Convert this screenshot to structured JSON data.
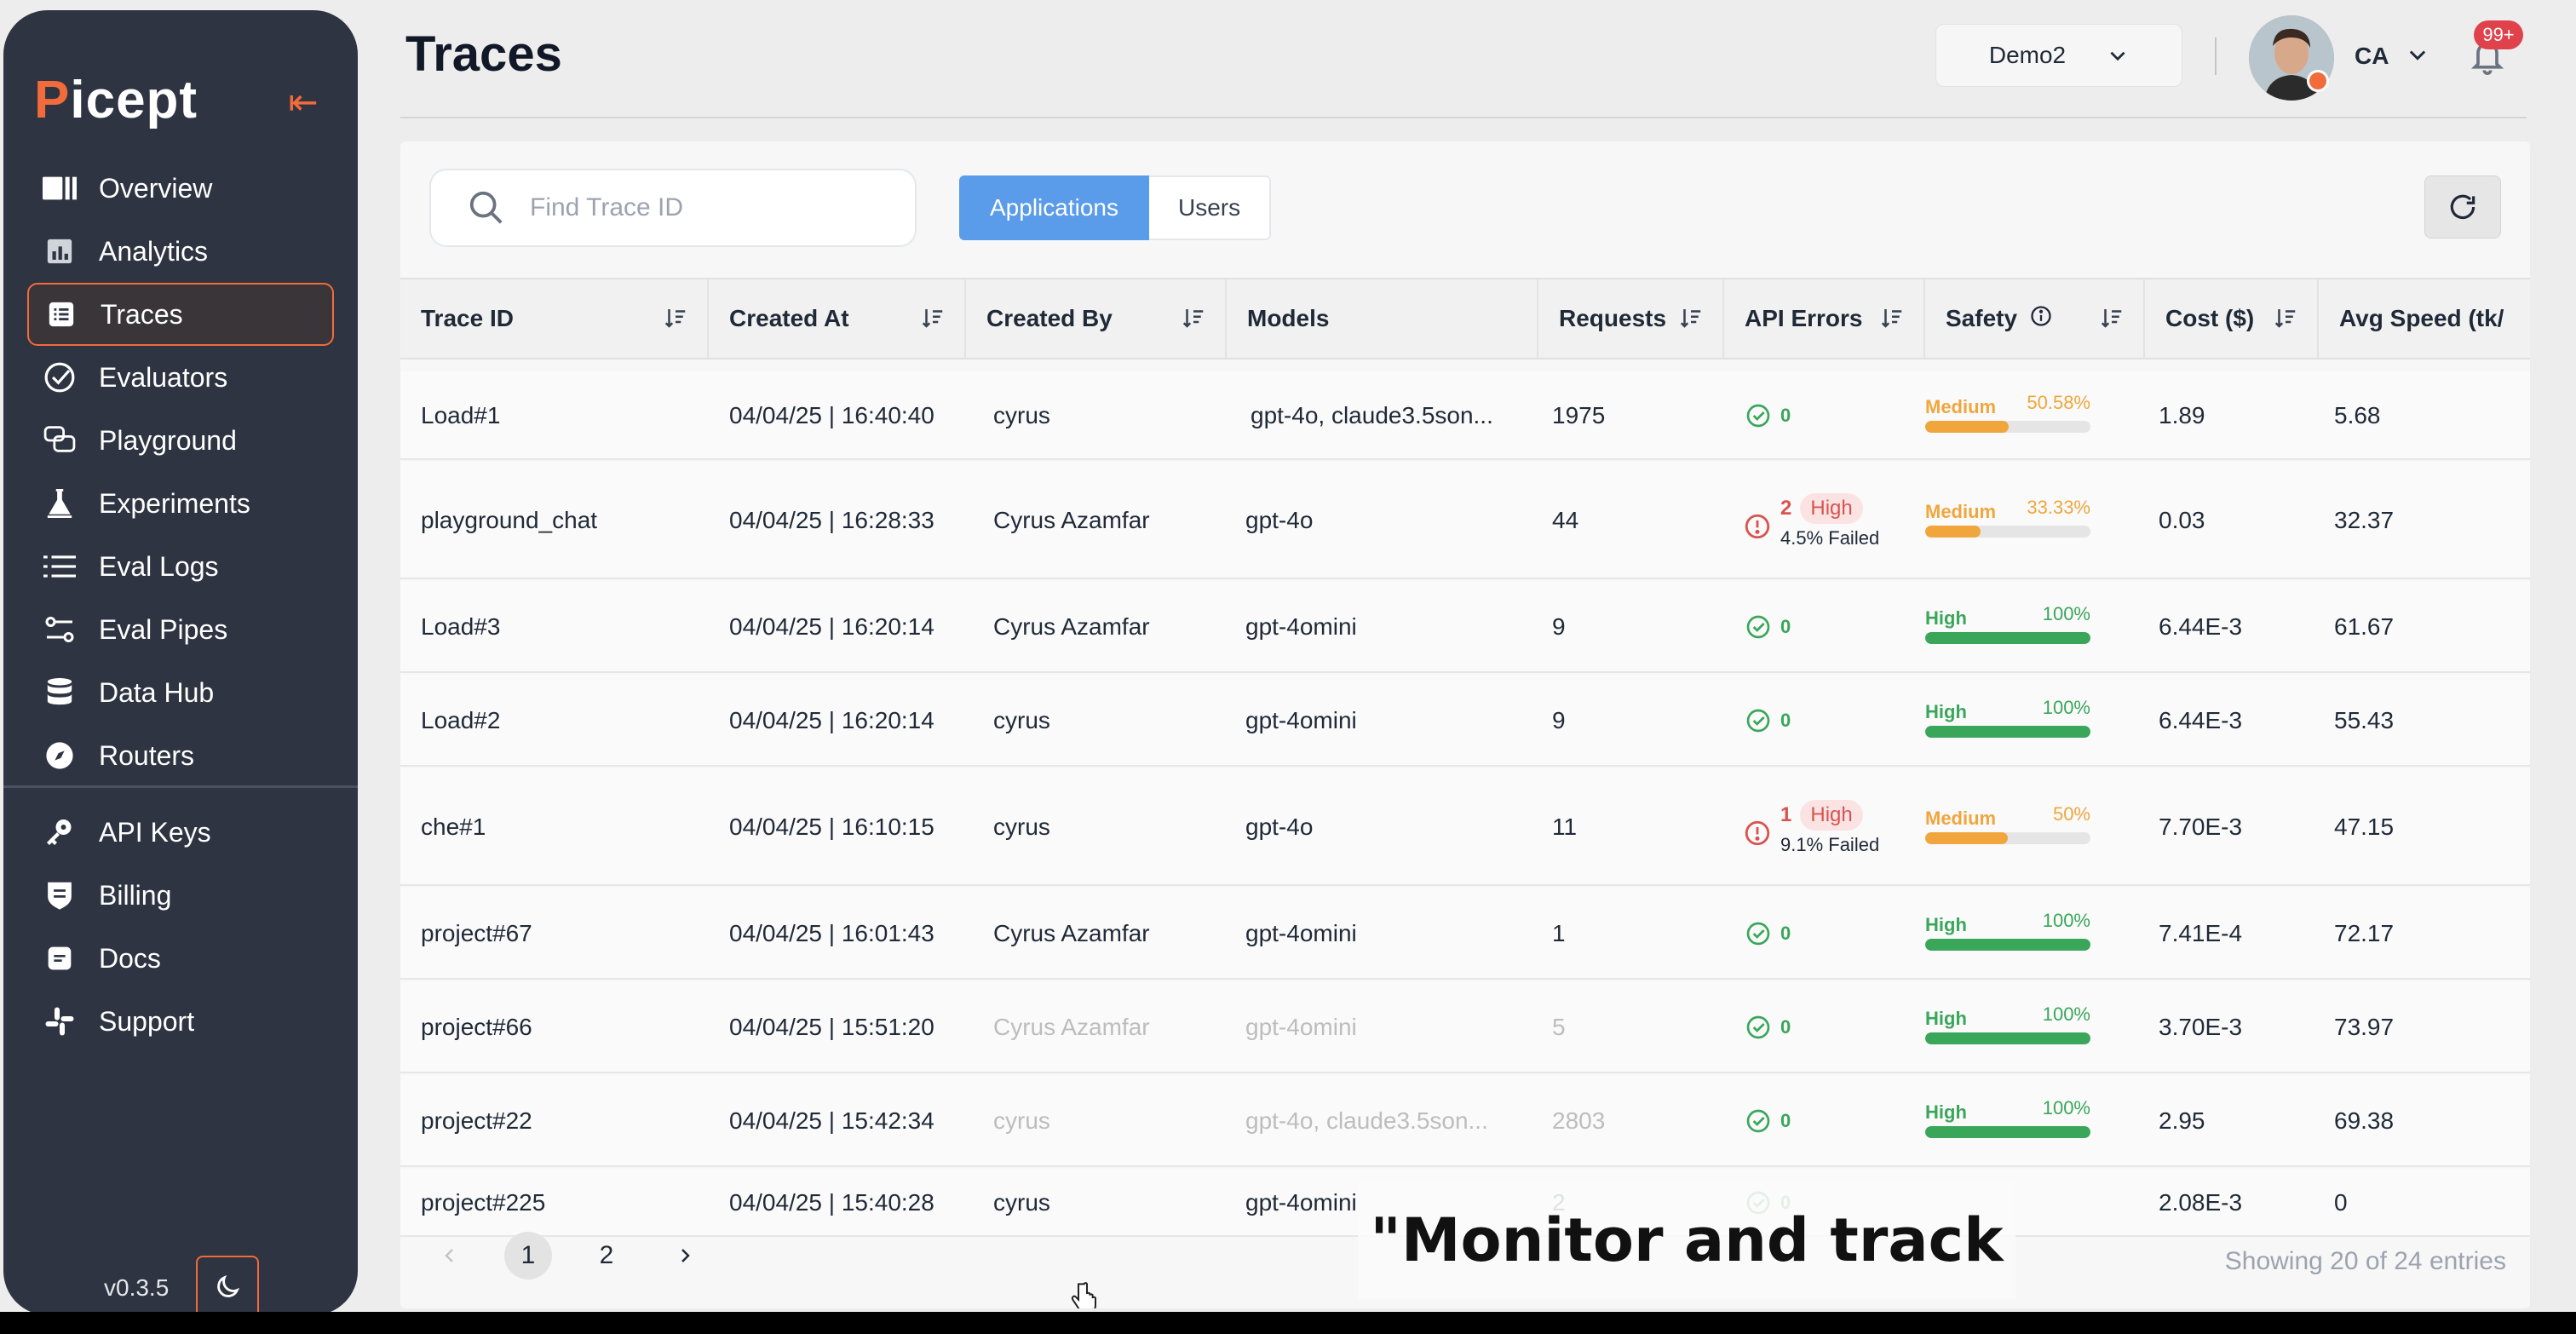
{
  "sidebar": {
    "logo": {
      "first": "P",
      "rest": "icept"
    },
    "collapse_icon": "collapse-left-arrow-icon",
    "items": [
      {
        "label": "Overview",
        "icon": "overview-icon"
      },
      {
        "label": "Analytics",
        "icon": "bar-chart-icon"
      },
      {
        "label": "Traces",
        "icon": "list-icon",
        "active": true
      },
      {
        "label": "Evaluators",
        "icon": "check-circle-icon"
      },
      {
        "label": "Playground",
        "icon": "chat-icon"
      },
      {
        "label": "Experiments",
        "icon": "flask-icon"
      },
      {
        "label": "Eval Logs",
        "icon": "list-lines-icon"
      },
      {
        "label": "Eval Pipes",
        "icon": "pipeline-icon"
      },
      {
        "label": "Data Hub",
        "icon": "database-icon"
      },
      {
        "label": "Routers",
        "icon": "compass-icon"
      }
    ],
    "secondary_items": [
      {
        "label": "API Keys",
        "icon": "key-icon"
      },
      {
        "label": "Billing",
        "icon": "shield-icon"
      },
      {
        "label": "Docs",
        "icon": "document-icon"
      },
      {
        "label": "Support",
        "icon": "slack-icon"
      }
    ],
    "version": "v0.3.5",
    "theme_icon": "moon-icon"
  },
  "header": {
    "title": "Traces",
    "workspace": "Demo2",
    "user_initials": "CA",
    "notifications_badge": "99+"
  },
  "toolbar": {
    "search_placeholder": "Find Trace ID",
    "tabs": [
      "Applications",
      "Users"
    ],
    "active_tab": "Applications"
  },
  "table": {
    "columns": [
      "Trace ID",
      "Created At",
      "Created By",
      "Models",
      "Requests",
      "API Errors",
      "Safety",
      "Cost ($)",
      "Avg Speed (tk/"
    ],
    "rows": [
      {
        "trace_id": "Load#1",
        "created_at": "04/04/25 | 16:40:40",
        "created_by": "cyrus",
        "models": "gpt-4o, claude3.5son...",
        "requests": "1975",
        "errors": "0",
        "error_severity": "",
        "failed": "",
        "safety": "Medium",
        "safety_pct": "50.58%",
        "safety_value": 0.5058,
        "cost": "1.89",
        "speed": "5.68"
      },
      {
        "trace_id": "playground_chat",
        "created_at": "04/04/25 | 16:28:33",
        "created_by": "Cyrus Azamfar",
        "models": "gpt-4o",
        "requests": "44",
        "errors": "2",
        "error_severity": "High",
        "failed": "4.5% Failed",
        "safety": "Medium",
        "safety_pct": "33.33%",
        "safety_value": 0.3333,
        "cost": "0.03",
        "speed": "32.37"
      },
      {
        "trace_id": "Load#3",
        "created_at": "04/04/25 | 16:20:14",
        "created_by": "Cyrus Azamfar",
        "models": "gpt-4omini",
        "requests": "9",
        "errors": "0",
        "error_severity": "",
        "failed": "",
        "safety": "High",
        "safety_pct": "100%",
        "safety_value": 1.0,
        "cost": "6.44E-3",
        "speed": "61.67"
      },
      {
        "trace_id": "Load#2",
        "created_at": "04/04/25 | 16:20:14",
        "created_by": "cyrus",
        "models": "gpt-4omini",
        "requests": "9",
        "errors": "0",
        "error_severity": "",
        "failed": "",
        "safety": "High",
        "safety_pct": "100%",
        "safety_value": 1.0,
        "cost": "6.44E-3",
        "speed": "55.43"
      },
      {
        "trace_id": "che#1",
        "created_at": "04/04/25 | 16:10:15",
        "created_by": "cyrus",
        "models": "gpt-4o",
        "requests": "11",
        "errors": "1",
        "error_severity": "High",
        "failed": "9.1% Failed",
        "safety": "Medium",
        "safety_pct": "50%",
        "safety_value": 0.5,
        "cost": "7.70E-3",
        "speed": "47.15"
      },
      {
        "trace_id": "project#67",
        "created_at": "04/04/25 | 16:01:43",
        "created_by": "Cyrus Azamfar",
        "models": "gpt-4omini",
        "requests": "1",
        "errors": "0",
        "error_severity": "",
        "failed": "",
        "safety": "High",
        "safety_pct": "100%",
        "safety_value": 1.0,
        "cost": "7.41E-4",
        "speed": "72.17"
      },
      {
        "trace_id": "project#66",
        "created_at": "04/04/25 | 15:51:20",
        "created_by": "Cyrus Azamfar",
        "models": "gpt-4omini",
        "requests": "5",
        "errors": "0",
        "error_severity": "",
        "failed": "",
        "safety": "High",
        "safety_pct": "100%",
        "safety_value": 1.0,
        "cost": "3.70E-3",
        "speed": "73.97"
      },
      {
        "trace_id": "project#22",
        "created_at": "04/04/25 | 15:42:34",
        "created_by": "cyrus",
        "models": "gpt-4o, claude3.5son...",
        "requests": "2803",
        "errors": "0",
        "error_severity": "",
        "failed": "",
        "safety": "High",
        "safety_pct": "100%",
        "safety_value": 1.0,
        "cost": "2.95",
        "speed": "69.38"
      },
      {
        "trace_id": "project#225",
        "created_at": "04/04/25 | 15:40:28",
        "created_by": "cyrus",
        "models": "gpt-4omini",
        "requests": "2",
        "errors": "0",
        "error_severity": "",
        "failed": "",
        "safety": "",
        "safety_pct": "",
        "safety_value": 0,
        "cost": "2.08E-3",
        "speed": "0"
      }
    ]
  },
  "pagination": {
    "pages": [
      "1",
      "2"
    ],
    "current": "1",
    "showing": "Showing 20 of 24 entries"
  },
  "caption": "\"Monitor and track",
  "colors": {
    "accent": "#f26b3a",
    "primary": "#5a9bea",
    "success": "#3aa65a",
    "warning": "#f0a63c",
    "danger": "#d9534f"
  }
}
